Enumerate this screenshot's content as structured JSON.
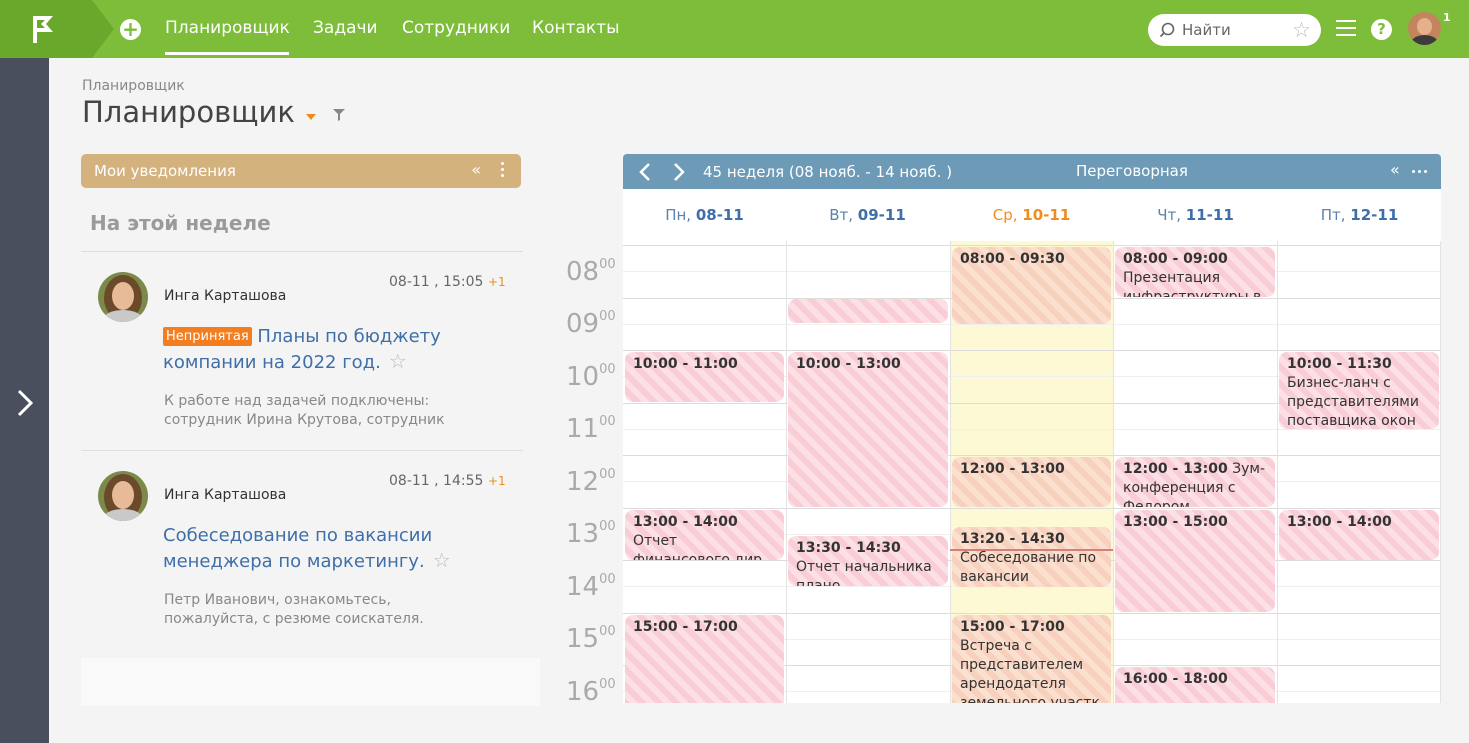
{
  "topbar": {
    "nav": [
      "Планировщик",
      "Задачи",
      "Сотрудники",
      "Контакты"
    ],
    "search_placeholder": "Найти",
    "notification_count": "1"
  },
  "page": {
    "breadcrumb": "Планировщик",
    "title": "Планировщик"
  },
  "notifications": {
    "header": "Мои уведомления",
    "collapse": "«",
    "week_label": "На этой неделе",
    "items": [
      {
        "author": "Инга Карташова",
        "time": "08-11 , 15:05",
        "plus": "+1",
        "tag": "Непринятая",
        "title": "Планы по бюджету компании на 2022 год.",
        "desc_line1": "К работе над задачей подключены:",
        "desc_line2": "сотрудник Ирина Крутова, сотрудник"
      },
      {
        "author": "Инга Карташова",
        "time": "08-11 , 14:55",
        "plus": "+1",
        "title": "Собеседование по вакансии менеджера по маркетингу.",
        "desc_line1": "Петр Иванович, ознакомьтесь,",
        "desc_line2": "пожалуйста, с резюме соискателя."
      }
    ]
  },
  "calendar": {
    "week": "45 неделя  (08 нояб. - 14 нояб. )",
    "room": "Переговорная",
    "collapse": "«",
    "days": [
      {
        "name": "Пн,",
        "date": "08-11"
      },
      {
        "name": "Вт,",
        "date": "09-11"
      },
      {
        "name": "Ср,",
        "date": "10-11"
      },
      {
        "name": "Чт,",
        "date": "11-11"
      },
      {
        "name": "Пт,",
        "date": "12-11"
      }
    ],
    "hours": [
      "08",
      "09",
      "10",
      "11",
      "12",
      "13",
      "14",
      "15",
      "16"
    ],
    "minutes": "00",
    "events": {
      "mon_1": {
        "time": "10:00 - 11:00",
        "text": ""
      },
      "mon_2": {
        "time": "13:00 - 14:00",
        "text": "Отчет финансового дир"
      },
      "mon_3": {
        "time": "15:00 - 17:00",
        "text": ""
      },
      "tue_2": {
        "time": "10:00 - 13:00",
        "text": ""
      },
      "tue_3": {
        "time": "13:30 - 14:30",
        "text": "Отчет начальника плано"
      },
      "wed_1": {
        "time": "08:00 - 09:30",
        "text": ""
      },
      "wed_2": {
        "time": "12:00 - 13:00",
        "text": ""
      },
      "wed_3": {
        "time": "13:20 - 14:30",
        "text": "Собеседование по вакансии менеджера п"
      },
      "wed_4": {
        "time": "15:00 - 17:00",
        "text": "Встреча с представителем арендодателя земельного участк"
      },
      "thu_1": {
        "time": "08:00 - 09:00",
        "text": "Презентация инфраструктуры в целом"
      },
      "thu_2": {
        "time": "12:00 - 13:00",
        "text": "Зум-конференция с Федором Андреевым"
      },
      "thu_3": {
        "time": "13:00 - 15:00",
        "text": ""
      },
      "thu_4": {
        "time": "16:00 - 18:00",
        "text": ""
      },
      "fri_1": {
        "time": "10:00 - 11:30",
        "text": "Бизнес-ланч с представителями поставщика окон"
      },
      "fri_2": {
        "time": "13:00 - 14:00",
        "text": ""
      }
    }
  }
}
